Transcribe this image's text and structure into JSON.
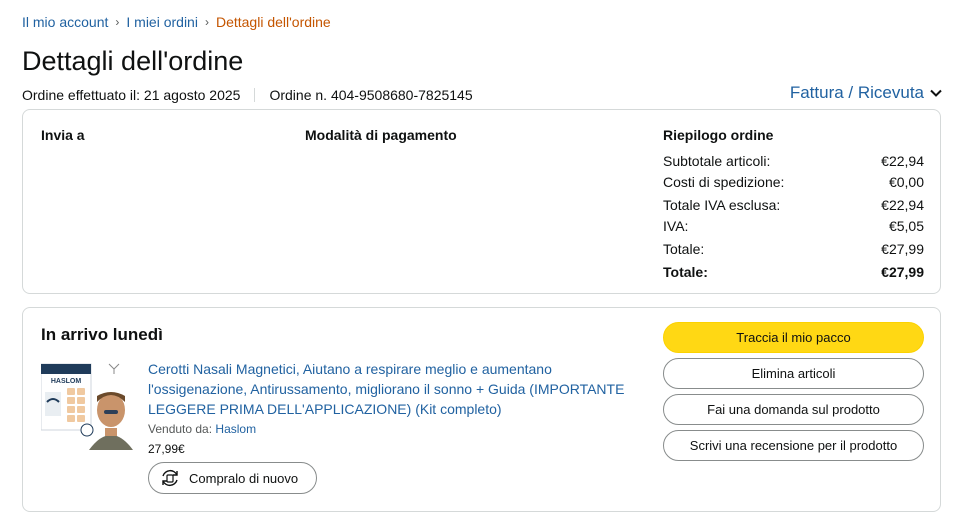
{
  "breadcrumb": {
    "items": [
      "Il mio account",
      "I miei ordini"
    ],
    "current": "Dettagli dell'ordine"
  },
  "page": {
    "title": "Dettagli dell'ordine",
    "order_date": "Ordine effettuato il: 21 agosto 2025",
    "order_number": "Ordine n. 404-9508680-7825145",
    "invoice_label": "Fattura / Ricevuta"
  },
  "details": {
    "ship_to_title": "Invia a",
    "payment_title": "Modalità di pagamento",
    "summary_title": "Riepilogo ordine",
    "summary": [
      {
        "label": "Subtotale articoli:",
        "value": "€22,94"
      },
      {
        "label": "Costi di spedizione:",
        "value": "€0,00"
      },
      {
        "label": "Totale IVA esclusa:",
        "value": "€22,94"
      },
      {
        "label": "IVA:",
        "value": "€5,05"
      },
      {
        "label": "Totale:",
        "value": "€27,99"
      },
      {
        "label": "Totale:",
        "value": "€27,99"
      }
    ]
  },
  "shipment": {
    "arrival": "In arrivo lunedì",
    "product_title": "Cerotti Nasali Magnetici, Aiutano a respirare meglio e aumentano l'ossigenazione, Antirussamento, migliorano il sonno + Guida (IMPORTANTE LEGGERE PRIMA DELL'APPLICAZIONE) (Kit completo)",
    "sold_by_label": "Venduto da:",
    "seller": "Haslom",
    "price": "27,99€",
    "buy_again": "Compralo di nuovo",
    "brand_text": "HASLOM",
    "actions": [
      "Traccia il mio pacco",
      "Elimina articoli",
      "Fai una domanda sul prodotto",
      "Scrivi una recensione per il prodotto"
    ]
  },
  "colors": {
    "link": "#2162a1",
    "breadcrumb_current": "#c45500",
    "primary_button": "#ffd814",
    "text": "#0f1111"
  }
}
